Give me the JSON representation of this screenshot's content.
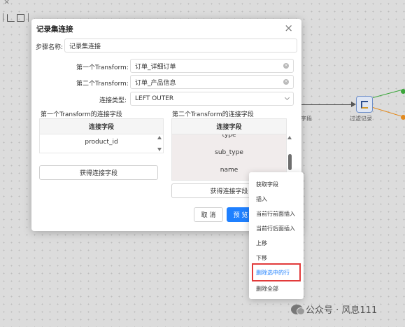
{
  "canvas": {
    "node_label": "过滤记录",
    "edge_label": "字段"
  },
  "dialog": {
    "title": "记录集连接",
    "close_glyph": "×",
    "step_name_label": "步骤名称:",
    "step_name_value": "记录集连接",
    "first_transform_label": "第一个Transform:",
    "first_transform_value": "订单_详细订单",
    "second_transform_label": "第二个Transform:",
    "second_transform_value": "订单_产品信息",
    "join_type_label": "连接类型:",
    "join_type_value": "LEFT OUTER",
    "first_fields_title": "第一个Transform的连接字段",
    "second_fields_title": "第二个Transform的连接字段",
    "grid1": {
      "header": "连接字段",
      "rows": [
        "product_id"
      ]
    },
    "grid2": {
      "header": "连接字段",
      "rows": [
        "type",
        "sub_type",
        "name"
      ]
    },
    "get_fields_btn_1": "获得连接字段",
    "get_fields_btn_2": "获得连接字段",
    "cancel_btn": "取 消",
    "preview_btn": "预 览"
  },
  "context_menu": {
    "items": [
      "获取字段",
      "插入",
      "当前行前面插入",
      "当前行后面插入",
      "上移",
      "下移",
      "删除选中的行",
      "删除全部"
    ],
    "active_index": 6
  },
  "watermark": {
    "text": "公众号 · 风息111"
  },
  "colors": {
    "primary": "#1f80ff",
    "highlight_border": "#e23b3b",
    "grid_selected_bg": "#f1ecec"
  }
}
